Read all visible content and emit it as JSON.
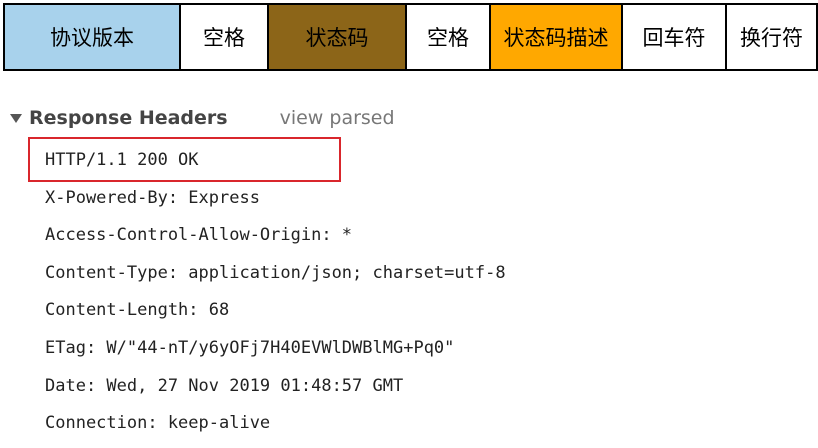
{
  "status_line_diagram": {
    "cells": [
      {
        "id": "protocol",
        "label": "协议版本",
        "bg": "#a8d2ec"
      },
      {
        "id": "space1",
        "label": "空格",
        "bg": "#ffffff"
      },
      {
        "id": "code",
        "label": "状态码",
        "bg": "#8c6518"
      },
      {
        "id": "space2",
        "label": "空格",
        "bg": "#ffffff"
      },
      {
        "id": "desc",
        "label": "状态码描述",
        "bg": "#ffa800"
      },
      {
        "id": "cr",
        "label": "回车符",
        "bg": "#ffffff"
      },
      {
        "id": "lf",
        "label": "换行符",
        "bg": "#ffffff"
      }
    ]
  },
  "response_headers": {
    "title": "Response Headers",
    "view_parsed_label": "view parsed",
    "status_line": "HTTP/1.1 200 OK",
    "highlight_color": "#d9262c",
    "lines": [
      "X-Powered-By: Express",
      "Access-Control-Allow-Origin: *",
      "Content-Type: application/json; charset=utf-8",
      "Content-Length: 68",
      "ETag: W/\"44-nT/y6yOFj7H40EVWlDWBlMG+Pq0\"",
      "Date: Wed, 27 Nov 2019 01:48:57 GMT",
      "Connection: keep-alive"
    ]
  },
  "icons": {
    "collapse_toggle": "triangle-down-icon"
  }
}
